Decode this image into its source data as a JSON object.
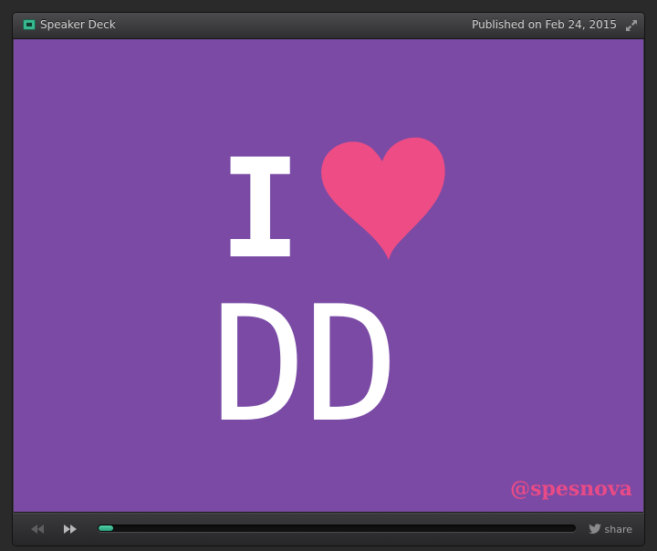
{
  "titlebar": {
    "brand": "Speaker Deck",
    "published": "Published on Feb 24, 2015"
  },
  "slide": {
    "line1": "I",
    "line2": "DD",
    "handle": "@spesnova",
    "background": "#7a4aa5",
    "heart_color": "#ee4c85"
  },
  "controls": {
    "progress_fraction": 0.03,
    "share_label": "share"
  },
  "icons": [
    "speaker-deck-icon",
    "expand-icon",
    "heart-icon",
    "rewind-icon",
    "fast-forward-icon",
    "twitter-bird-icon"
  ]
}
